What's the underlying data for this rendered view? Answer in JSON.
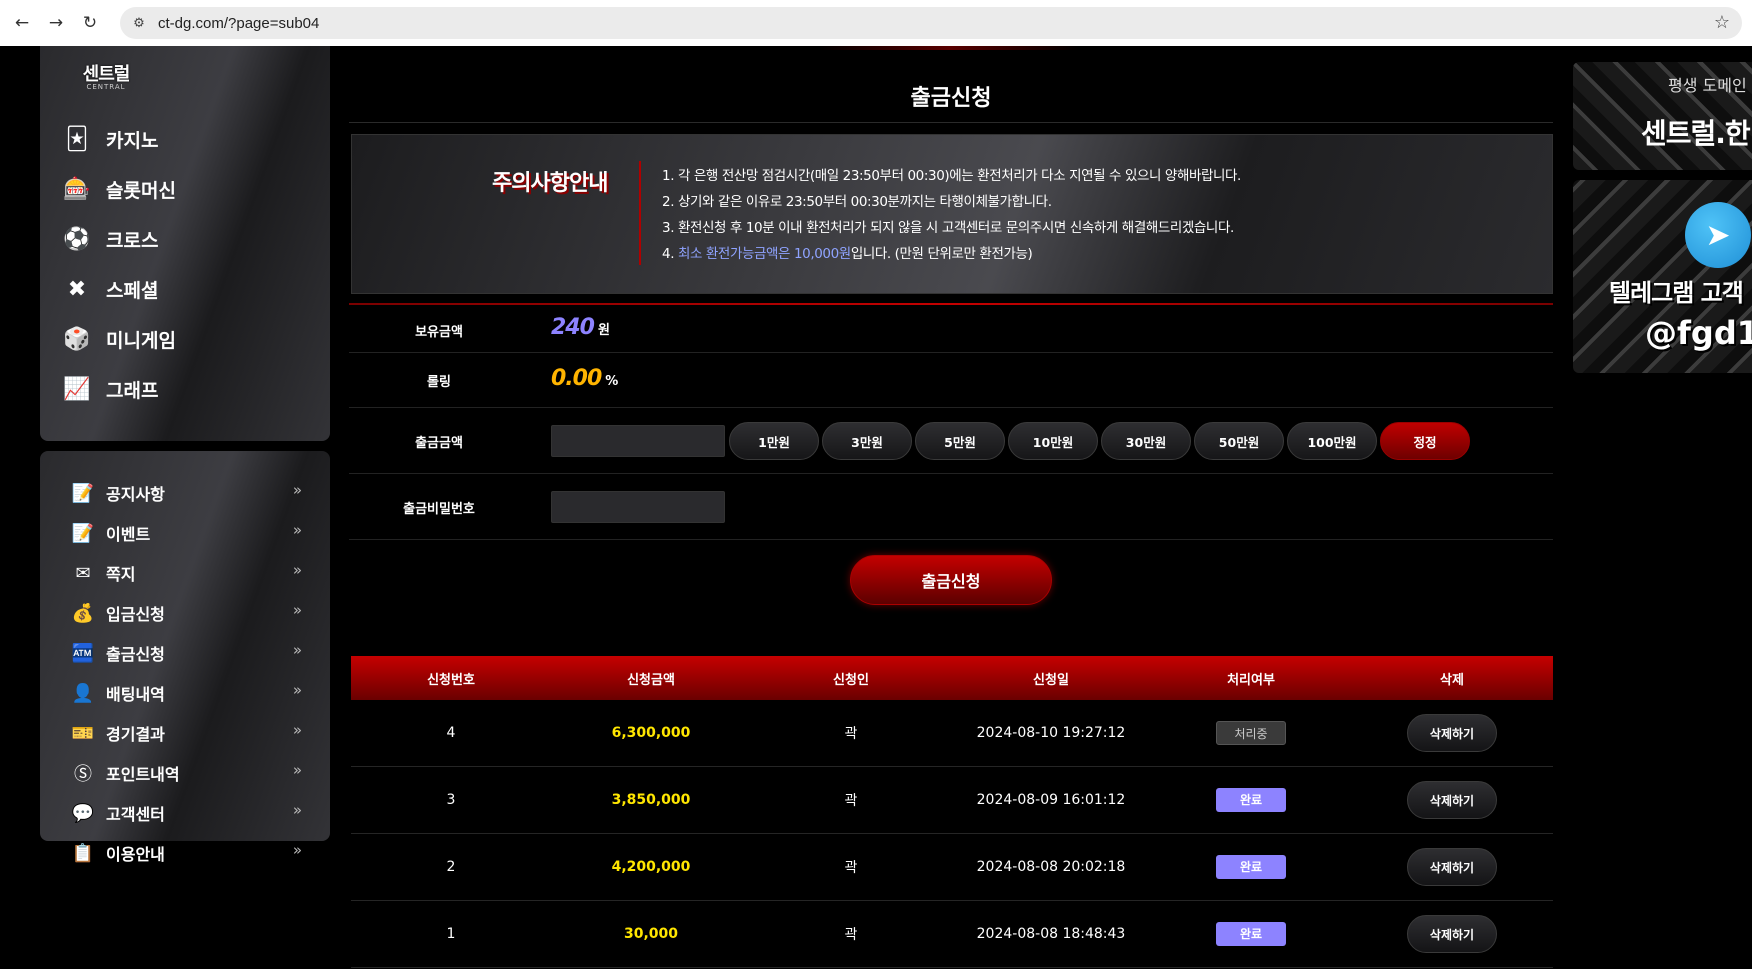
{
  "browser": {
    "url": "ct-dg.com/?page=sub04"
  },
  "logo": {
    "main": "센트럴",
    "sub": "CENTRAL"
  },
  "game_menu": [
    {
      "label": "카지노",
      "icon": "casino-icon",
      "glyph": "🃏"
    },
    {
      "label": "슬롯머신",
      "icon": "slot-icon",
      "glyph": "🎰"
    },
    {
      "label": "크로스",
      "icon": "soccer-ball-icon",
      "glyph": "⚽"
    },
    {
      "label": "스페셜",
      "icon": "crossed-sticks-icon",
      "glyph": "✖"
    },
    {
      "label": "미니게임",
      "icon": "minigame-icon",
      "glyph": "🎲"
    },
    {
      "label": "그래프",
      "icon": "graph-icon",
      "glyph": "📈"
    }
  ],
  "side_menu": [
    {
      "label": "공지사항",
      "icon": "notice-icon",
      "glyph": "📝"
    },
    {
      "label": "이벤트",
      "icon": "event-icon",
      "glyph": "📝"
    },
    {
      "label": "쪽지",
      "icon": "mail-icon",
      "glyph": "✉"
    },
    {
      "label": "입금신청",
      "icon": "deposit-icon",
      "glyph": "💰"
    },
    {
      "label": "출금신청",
      "icon": "withdraw-icon",
      "glyph": "🏧"
    },
    {
      "label": "배팅내역",
      "icon": "betting-history-icon",
      "glyph": "👤"
    },
    {
      "label": "경기결과",
      "icon": "bet-result-icon",
      "glyph": "🎫"
    },
    {
      "label": "포인트내역",
      "icon": "point-icon",
      "glyph": "Ⓢ"
    },
    {
      "label": "고객센터",
      "icon": "support-icon",
      "glyph": "💬"
    },
    {
      "label": "이용안내",
      "icon": "guide-icon",
      "glyph": "📋"
    }
  ],
  "side_arrow": "»",
  "page_title": "출금신청",
  "notice": {
    "title": "주의사항안내",
    "lines": [
      "1. 각 은행 전산망 점검시간(매일 23:50부터 00:30)에는 환전처리가 다소 지연될 수 있으니 양해바랍니다.",
      "2. 상기와 같은 이유로 23:50부터 00:30분까지는 타행이체불가합니다.",
      "3. 환전신청 후 10분 이내 환전처리가 되지 않을 시 고객센터로 문의주시면 신속하게 해결해드리겠습니다."
    ],
    "line4_prefix": "4. ",
    "line4_highlight": "최소 환전가능금액은 10,000원",
    "line4_suffix": "입니다. (만원 단위로만 환전가능)"
  },
  "form": {
    "balance_label": "보유금액",
    "balance_value": "240",
    "balance_unit": "원",
    "rolling_label": "롤링",
    "rolling_value": "0.00",
    "rolling_unit": "%",
    "amount_label": "출금금액",
    "amount_value": "",
    "amount_buttons": [
      "1만원",
      "3만원",
      "5만원",
      "10만원",
      "30만원",
      "50만원",
      "100만원"
    ],
    "reset_button": "정정",
    "password_label": "출금비밀번호",
    "password_value": "",
    "submit_label": "출금신청"
  },
  "colors": {
    "balance": "#8d83ff",
    "rolling": "#ffb400",
    "amount": "#ffe600",
    "done": "#8d83ff",
    "accent": "#c40000"
  },
  "table": {
    "headers": [
      "신청번호",
      "신청금액",
      "신청인",
      "신청일",
      "처리여부",
      "삭제"
    ],
    "rows": [
      {
        "no": "4",
        "amount": "6,300,000",
        "name": "곽",
        "date": "2024-08-10 19:27:12",
        "status": "처리중",
        "status_type": "proc",
        "action": "삭제하기"
      },
      {
        "no": "3",
        "amount": "3,850,000",
        "name": "곽",
        "date": "2024-08-09 16:01:12",
        "status": "완료",
        "status_type": "done",
        "action": "삭제하기"
      },
      {
        "no": "2",
        "amount": "4,200,000",
        "name": "곽",
        "date": "2024-08-08 20:02:18",
        "status": "완료",
        "status_type": "done",
        "action": "삭제하기"
      },
      {
        "no": "1",
        "amount": "30,000",
        "name": "곽",
        "date": "2024-08-08 18:48:43",
        "status": "완료",
        "status_type": "done",
        "action": "삭제하기"
      }
    ]
  },
  "banners": {
    "banner1_small": "평생 도메인",
    "banner1_big": "센트럴.한",
    "banner2_line1": "텔레그램 고객",
    "banner2_line2": "@fgd1"
  }
}
